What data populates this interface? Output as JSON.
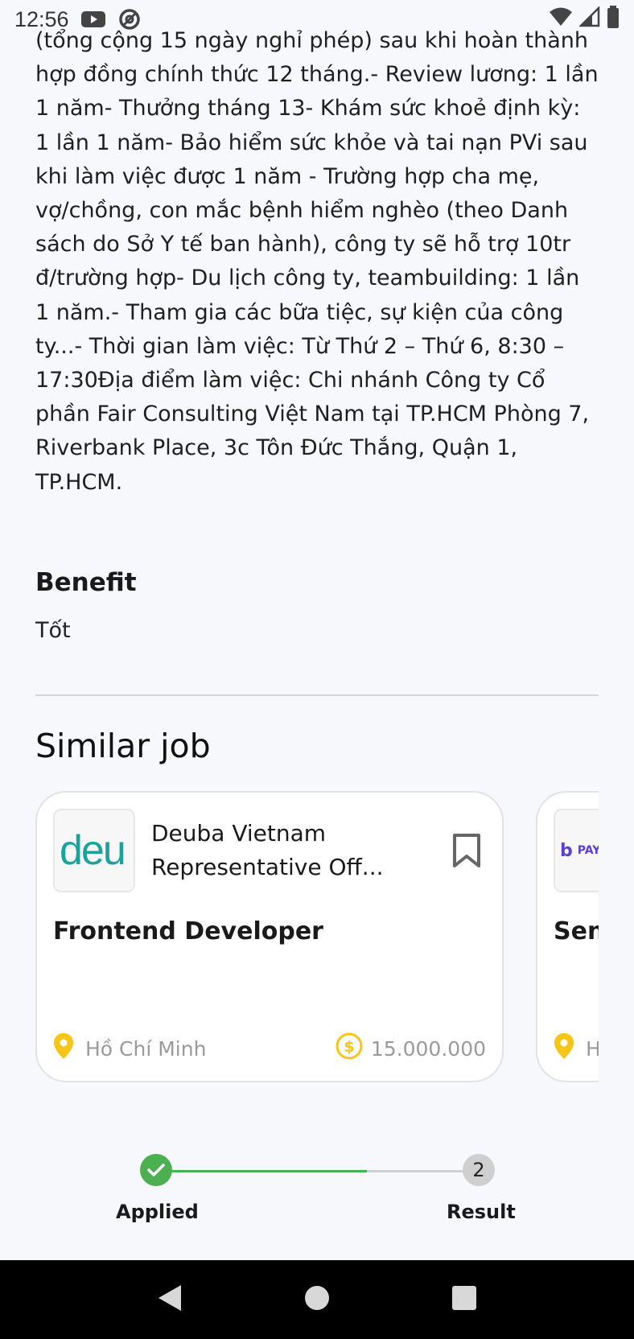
{
  "status_bar": {
    "time": "12:56"
  },
  "description": {
    "text": "(tổng cộng 15 ngày nghỉ phép) sau khi hoàn thành hợp đồng chính thức 12 tháng.- Review lương: 1 lần 1 năm- Thưởng tháng 13- Khám sức khoẻ định kỳ: 1 lần 1 năm- Bảo hiểm sức khỏe và tai nạn PVi sau khi làm việc được 1 năm - Trường hợp cha mẹ, vợ/chồng, con mắc bệnh hiểm nghèo (theo Danh sách do Sở Y tế ban hành), công ty sẽ hỗ trợ 10tr đ/trường hợp- Du lịch công ty, teambuilding: 1 lần 1 năm.- Tham gia các bữa tiệc, sự kiện của công ty...- Thời gian làm việc: Từ Thứ 2 – Thứ 6, 8:30 – 17:30Địa điểm làm việc: Chi nhánh Công ty Cổ phần Fair Consulting Việt Nam tại TP.HCM Phòng 7, Riverbank Place, 3c Tôn Đức Thắng, Quận 1, TP.HCM."
  },
  "benefit": {
    "title": "Benefit",
    "text": "Tốt"
  },
  "similar": {
    "title": "Similar job",
    "cards": [
      {
        "logo_text": "deu",
        "company": "Deuba Vietnam Representative Off...",
        "job_title": "Frontend Developer",
        "location": "Hồ Chí Minh",
        "salary": "15.000.000"
      },
      {
        "logo_text": "PAY",
        "company": "",
        "job_title": "Sen",
        "location": "H",
        "salary": ""
      }
    ]
  },
  "stepper": {
    "steps": [
      {
        "label": "Applied",
        "done": true
      },
      {
        "label": "Result",
        "number": "2",
        "done": false
      }
    ]
  },
  "colors": {
    "accent_green": "#4caf50",
    "icon_yellow": "#f5c518",
    "logo_teal": "#1aa39a",
    "logo_purple": "#5b3fd6"
  }
}
